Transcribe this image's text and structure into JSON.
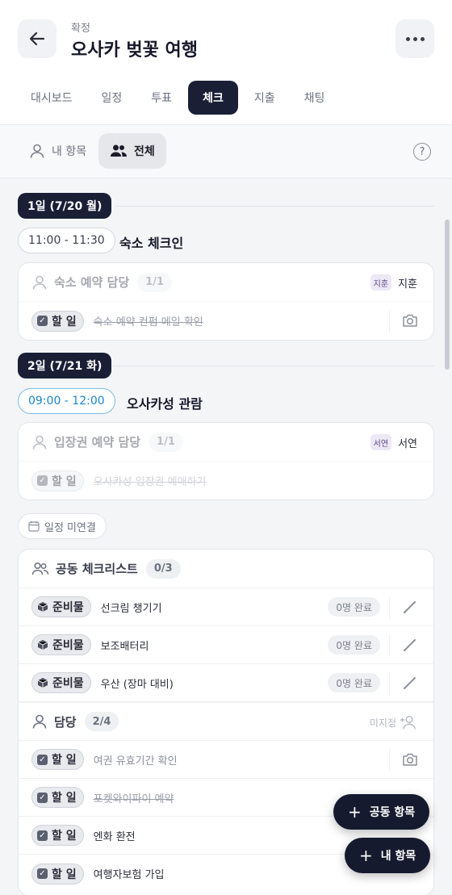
{
  "header": {
    "status": "확정",
    "title": "오사카 벚꽃 여행",
    "tabs": [
      {
        "label": "대시보드"
      },
      {
        "label": "일정"
      },
      {
        "label": "투표"
      },
      {
        "label": "체크"
      },
      {
        "label": "지출"
      },
      {
        "label": "채팅"
      }
    ],
    "active_tab": "체크"
  },
  "filters": {
    "mine_label": "내 항목",
    "all_label": "전체",
    "help_glyph": "?"
  },
  "days": [
    {
      "badge": "1일 (7/20 월)",
      "time": "11:00 - 11:30",
      "title": "숙소 체크인",
      "card": {
        "title": "숙소 예약 담당",
        "count": "1/1",
        "assignee_tag": "지훈",
        "assignee_name": "지훈",
        "item_tag": "할 일",
        "item_text": "숙소 예약 컨펌 메일 확인"
      }
    },
    {
      "badge": "2일 (7/21 화)",
      "time": "09:00 - 12:00",
      "title": "오사카성 관람",
      "card": {
        "title": "입장권 예약 담당",
        "count": "1/1",
        "assignee_tag": "서연",
        "assignee_name": "서연",
        "item_tag": "할 일",
        "item_text": "오사카성 입장권 예매하기"
      }
    }
  ],
  "unlinked": {
    "label": "일정 미연결",
    "shared": {
      "title": "공동 체크리스트",
      "count": "0/3",
      "items": [
        {
          "tag": "준비물",
          "text": "선크림 챙기기",
          "status": "0명 완료"
        },
        {
          "tag": "준비물",
          "text": "보조배터리",
          "status": "0명 완료"
        },
        {
          "tag": "준비물",
          "text": "우산 (장마 대비)",
          "status": "0명 완료"
        }
      ]
    },
    "assigned": {
      "title": "담당",
      "count": "2/4",
      "unassigned_label": "미지정",
      "items": [
        {
          "tag": "할 일",
          "text": "여권 유효기간 확인"
        },
        {
          "tag": "할 일",
          "text": "포켓와이파이 예약"
        },
        {
          "tag": "할 일",
          "text": "엔화 환전"
        },
        {
          "tag": "할 일",
          "text": "여행자보험 가입"
        }
      ]
    }
  },
  "fabs": {
    "shared_label": "공동 항목",
    "mine_label": "내 항목"
  },
  "colors": {
    "primary_dark": "#1a1f36",
    "accent_blue": "#1a86cc",
    "background": "#f4f5f7"
  }
}
